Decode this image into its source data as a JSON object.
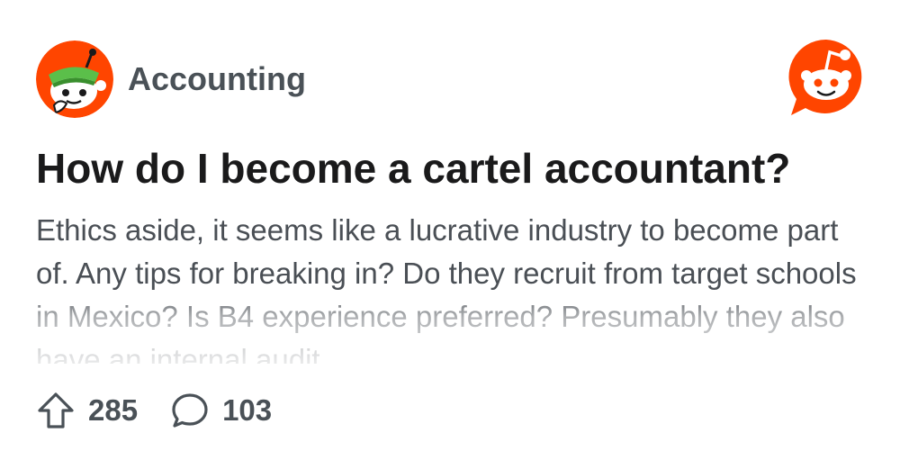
{
  "subreddit": {
    "name": "Accounting",
    "avatar_icon": "accounting-snoo-avatar-icon"
  },
  "brand": {
    "logo_icon": "reddit-logo-icon",
    "accent_color": "#ff4500"
  },
  "post": {
    "title": "How do I become a cartel accountant?",
    "body": "Ethics aside, it seems like a lucrative industry to become part of. Any tips for breaking in? Do they recruit from target schools in Mexico? Is B4 experience preferred? Presumably they also have an internal audit"
  },
  "stats": {
    "upvotes": "285",
    "upvote_icon": "upvote-arrow-icon",
    "comments": "103",
    "comment_icon": "comment-bubble-icon"
  }
}
